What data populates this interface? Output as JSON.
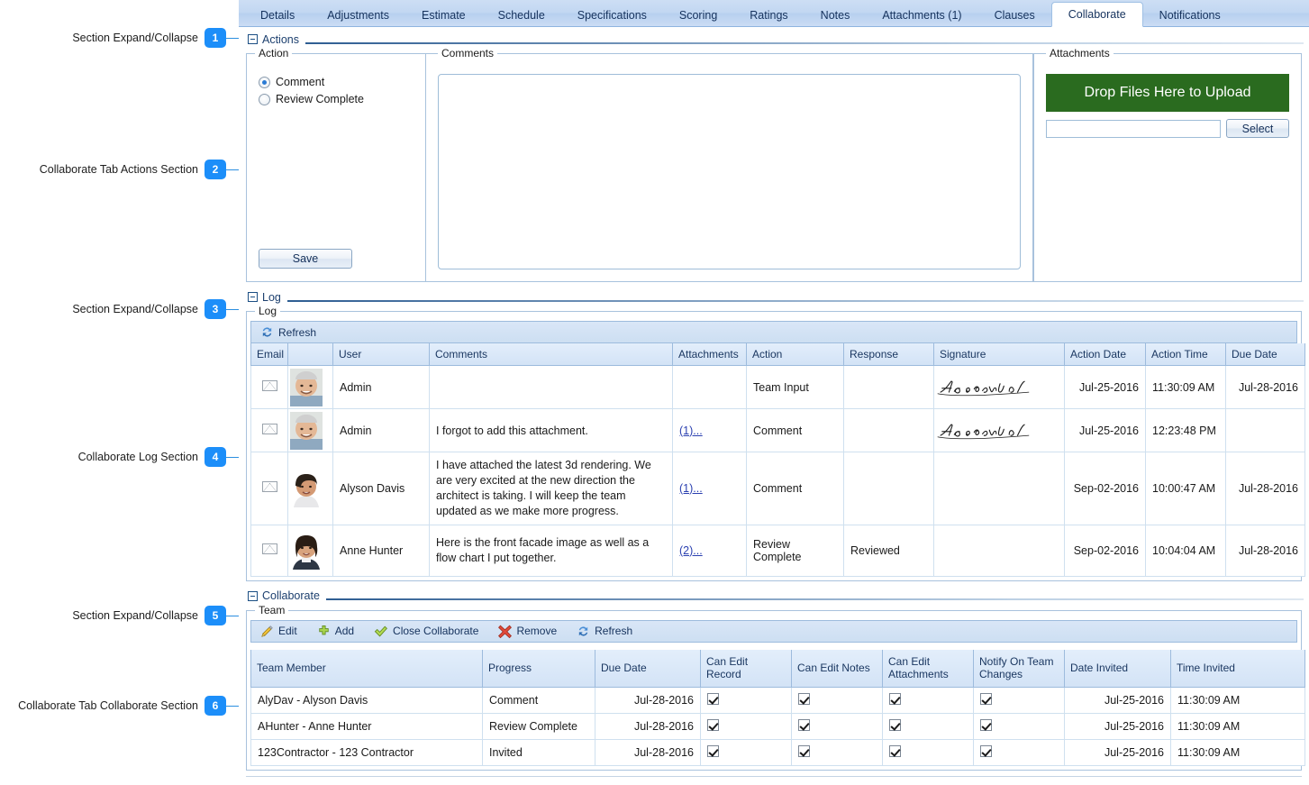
{
  "callouts": [
    {
      "label": "Section Expand/Collapse",
      "number": "1"
    },
    {
      "label": "Collaborate Tab Actions Section",
      "number": "2"
    },
    {
      "label": "Section Expand/Collapse",
      "number": "3"
    },
    {
      "label": "Collaborate Log Section",
      "number": "4"
    },
    {
      "label": "Section Expand/Collapse",
      "number": "5"
    },
    {
      "label": "Collaborate Tab Collaborate Section",
      "number": "6"
    }
  ],
  "tabs": [
    {
      "label": "Details",
      "active": false
    },
    {
      "label": "Adjustments",
      "active": false
    },
    {
      "label": "Estimate",
      "active": false
    },
    {
      "label": "Schedule",
      "active": false
    },
    {
      "label": "Specifications",
      "active": false
    },
    {
      "label": "Scoring",
      "active": false
    },
    {
      "label": "Ratings",
      "active": false
    },
    {
      "label": "Notes",
      "active": false
    },
    {
      "label": "Attachments (1)",
      "active": false
    },
    {
      "label": "Clauses",
      "active": false
    },
    {
      "label": "Collaborate",
      "active": true
    },
    {
      "label": "Notifications",
      "active": false
    }
  ],
  "sections": {
    "actions_title": "Actions",
    "log_title": "Log",
    "collaborate_title": "Collaborate"
  },
  "actions": {
    "action_group_label": "Action",
    "radios": [
      {
        "label": "Comment",
        "selected": true
      },
      {
        "label": "Review Complete",
        "selected": false
      }
    ],
    "save_label": "Save",
    "comments_group_label": "Comments",
    "comments_value": "",
    "attachments_group_label": "Attachments",
    "drop_label": "Drop Files Here to Upload",
    "file_value": "",
    "select_label": "Select",
    "drop_color": "#2a6b1f"
  },
  "log": {
    "group_label": "Log",
    "toolbar": [
      {
        "label": "Refresh",
        "icon": "refresh-icon"
      }
    ],
    "columns": [
      "Email",
      "",
      "User",
      "Comments",
      "Attachments",
      "Action",
      "Response",
      "Signature",
      "Action Date",
      "Action Time",
      "Due Date"
    ],
    "rows": [
      {
        "email": "mail-icon",
        "avatar": "avatar-admin-male",
        "user": "Admin",
        "comments": "",
        "attachments": "",
        "action": "Team Input",
        "response": "",
        "signature": "A. Lincoln",
        "action_date": "Jul-25-2016",
        "action_time": "11:30:09 AM",
        "due_date": "Jul-28-2016"
      },
      {
        "email": "mail-icon",
        "avatar": "avatar-admin-male",
        "user": "Admin",
        "comments": "I forgot to add this attachment.",
        "attachments": "(1)...",
        "action": "Comment",
        "response": "",
        "signature": "A. Lincoln",
        "action_date": "Jul-25-2016",
        "action_time": "12:23:48 PM",
        "due_date": ""
      },
      {
        "email": "mail-icon",
        "avatar": "avatar-alyson-davis",
        "user": "Alyson Davis",
        "comments": "I have attached the latest 3d rendering. We are very excited at the new direction the architect is taking. I will keep the team updated as we make more progress.",
        "attachments": "(1)...",
        "action": "Comment",
        "response": "",
        "signature": "",
        "action_date": "Sep-02-2016",
        "action_time": "10:00:47 AM",
        "due_date": "Jul-28-2016"
      },
      {
        "email": "mail-icon",
        "avatar": "avatar-anne-hunter",
        "user": "Anne Hunter",
        "comments": "Here is the front facade image as well as a flow chart I put together.",
        "attachments": "(2)...",
        "action": "Review Complete",
        "response": "Reviewed",
        "signature": "",
        "action_date": "Sep-02-2016",
        "action_time": "10:04:04 AM",
        "due_date": "Jul-28-2016"
      }
    ]
  },
  "team": {
    "group_label": "Team",
    "toolbar": [
      {
        "label": "Edit",
        "icon": "pencil-icon"
      },
      {
        "label": "Add",
        "icon": "plus-icon"
      },
      {
        "label": "Close Collaborate",
        "icon": "check-icon"
      },
      {
        "label": "Remove",
        "icon": "x-icon"
      },
      {
        "label": "Refresh",
        "icon": "refresh-icon"
      }
    ],
    "columns": [
      "Team Member",
      "Progress",
      "Due Date",
      "Can Edit Record",
      "Can Edit Notes",
      "Can Edit Attachments",
      "Notify On Team Changes",
      "Date Invited",
      "Time Invited"
    ],
    "rows": [
      {
        "member": "AlyDav - Alyson Davis",
        "progress": "Comment",
        "due_date": "Jul-28-2016",
        "can_edit_record": true,
        "can_edit_notes": true,
        "can_edit_attachments": true,
        "notify_on_team_changes": true,
        "date_invited": "Jul-25-2016",
        "time_invited": "11:30:09 AM"
      },
      {
        "member": "AHunter - Anne Hunter",
        "progress": "Review Complete",
        "due_date": "Jul-28-2016",
        "can_edit_record": true,
        "can_edit_notes": true,
        "can_edit_attachments": true,
        "notify_on_team_changes": true,
        "date_invited": "Jul-25-2016",
        "time_invited": "11:30:09 AM"
      },
      {
        "member": "123Contractor - 123 Contractor",
        "progress": "Invited",
        "due_date": "Jul-28-2016",
        "can_edit_record": true,
        "can_edit_notes": true,
        "can_edit_attachments": true,
        "notify_on_team_changes": true,
        "date_invited": "Jul-25-2016",
        "time_invited": "11:30:09 AM"
      }
    ]
  },
  "colors": {
    "accent": "#1c8ef9",
    "tab_bar": "#c2d7f2",
    "grid_header": "#d8e6f8",
    "link": "#2a3fb0"
  }
}
